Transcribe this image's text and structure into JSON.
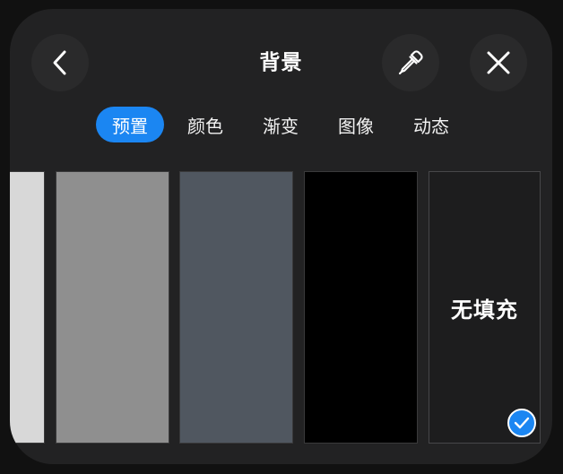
{
  "header": {
    "title": "背景",
    "back_icon": "chevron-left-icon",
    "picker_icon": "eyedropper-icon",
    "close_icon": "close-icon"
  },
  "tabs": [
    {
      "label": "预置",
      "active": true
    },
    {
      "label": "颜色",
      "active": false
    },
    {
      "label": "渐变",
      "active": false
    },
    {
      "label": "图像",
      "active": false
    },
    {
      "label": "动态",
      "active": false
    }
  ],
  "swatches": [
    {
      "name": "light-gray",
      "color": "#d8d8d8"
    },
    {
      "name": "gray",
      "color": "#8f8f8f"
    },
    {
      "name": "slate",
      "color": "#505760"
    },
    {
      "name": "black",
      "color": "#000000"
    },
    {
      "name": "none",
      "label": "无填充",
      "selected": true
    }
  ],
  "colors": {
    "accent": "#1b86f2",
    "panel": "#222223"
  }
}
